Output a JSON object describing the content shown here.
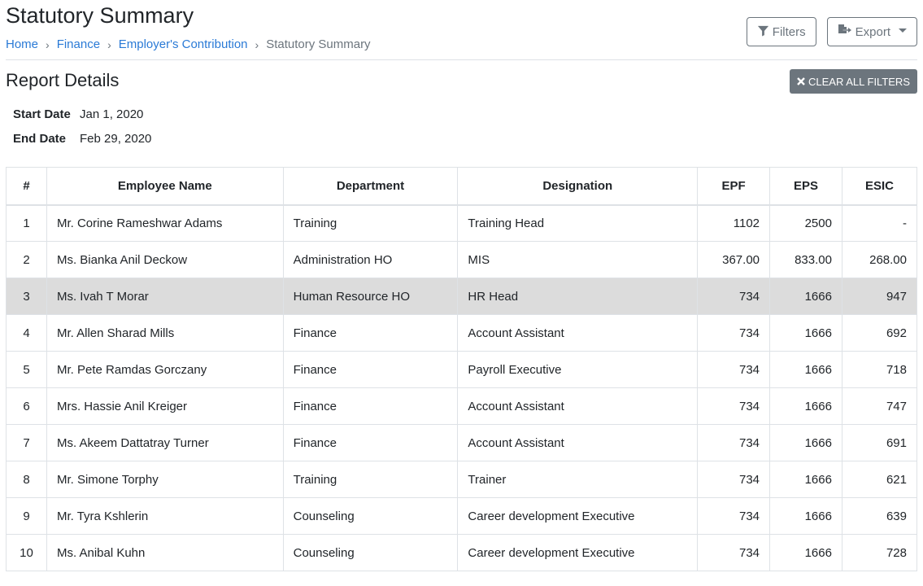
{
  "page": {
    "title": "Statutory Summary",
    "breadcrumb": [
      {
        "label": "Home"
      },
      {
        "label": "Finance"
      },
      {
        "label": "Employer's Contribution"
      },
      {
        "label": "Statutory Summary"
      }
    ]
  },
  "actions": {
    "filters_label": "Filters",
    "export_label": "Export"
  },
  "report": {
    "title": "Report Details",
    "clear_filters_label": "CLEAR ALL FILTERS",
    "start_date_label": "Start Date",
    "start_date": "Jan 1, 2020",
    "end_date_label": "End Date",
    "end_date": "Feb 29, 2020"
  },
  "table": {
    "columns": [
      "#",
      "Employee Name",
      "Department",
      "Designation",
      "EPF",
      "EPS",
      "ESIC"
    ],
    "highlighted_row": 2,
    "rows": [
      [
        "1",
        "Mr. Corine Rameshwar Adams",
        "Training",
        "Training Head",
        "1102",
        "2500",
        "-"
      ],
      [
        "2",
        "Ms. Bianka Anil Deckow",
        "Administration HO",
        "MIS",
        "367.00",
        "833.00",
        "268.00"
      ],
      [
        "3",
        "Ms. Ivah T Morar",
        "Human Resource HO",
        "HR Head",
        "734",
        "1666",
        "947"
      ],
      [
        "4",
        "Mr. Allen Sharad Mills",
        "Finance",
        "Account Assistant",
        "734",
        "1666",
        "692"
      ],
      [
        "5",
        "Mr. Pete Ramdas Gorczany",
        "Finance",
        "Payroll Executive",
        "734",
        "1666",
        "718"
      ],
      [
        "6",
        "Mrs. Hassie Anil Kreiger",
        "Finance",
        "Account Assistant",
        "734",
        "1666",
        "747"
      ],
      [
        "7",
        "Ms. Akeem Dattatray Turner",
        "Finance",
        "Account Assistant",
        "734",
        "1666",
        "691"
      ],
      [
        "8",
        "Mr. Simone Torphy",
        "Training",
        "Trainer",
        "734",
        "1666",
        "621"
      ],
      [
        "9",
        "Mr. Tyra Kshlerin",
        "Counseling",
        "Career development Executive",
        "734",
        "1666",
        "639"
      ],
      [
        "10",
        "Ms. Anibal Kuhn",
        "Counseling",
        "Career development Executive",
        "734",
        "1666",
        "728"
      ]
    ]
  }
}
